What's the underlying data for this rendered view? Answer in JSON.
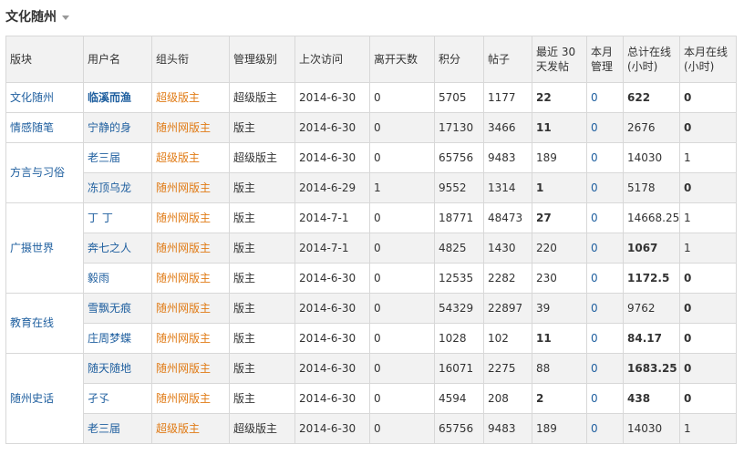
{
  "page_title": "文化随州",
  "columns": [
    "版块",
    "用户名",
    "组头衔",
    "管理级别",
    "上次访问",
    "离开天数",
    "积分",
    "帖子",
    "最近 30 天发帖",
    "本月管理",
    "总计在线(小时)",
    "本月在线(小时)"
  ],
  "header": {
    "section": "版块",
    "user": "用户名",
    "title": "组头衔",
    "level": "管理级别",
    "last_visit": "上次访问",
    "days_away": "离开天数",
    "points": "积分",
    "posts": "帖子",
    "recent30_a": "最近 30",
    "recent30_b": "天发帖",
    "month_manage_a": "本月",
    "month_manage_b": "管理",
    "total_online_a": "总计在线",
    "total_online_b": "(小时)",
    "month_online_a": "本月在线",
    "month_online_b": "(小时)"
  },
  "sections": [
    "文化随州",
    "情感随笔",
    "方言与习俗",
    "广摄世界",
    "教育在线",
    "随州史话"
  ],
  "rows": [
    {
      "user": "临溪而渔",
      "title": "超级版主",
      "level": "超级版主",
      "last": "2014-6-30",
      "days": "0",
      "points": "5705",
      "posts": "1177",
      "recent": "22",
      "manage": "0",
      "total": "622",
      "month": "0"
    },
    {
      "user": "宁静的身",
      "title": "随州网版主",
      "level": "版主",
      "last": "2014-6-30",
      "days": "0",
      "points": "17130",
      "posts": "3466",
      "recent": "11",
      "manage": "0",
      "total": "2676",
      "month": "0"
    },
    {
      "user": "老三届",
      "title": "超级版主",
      "level": "超级版主",
      "last": "2014-6-30",
      "days": "0",
      "points": "65756",
      "posts": "9483",
      "recent": "189",
      "manage": "0",
      "total": "14030",
      "month": "1"
    },
    {
      "user": "冻顶乌龙",
      "title": "随州网版主",
      "level": "版主",
      "last": "2014-6-29",
      "days": "1",
      "points": "9552",
      "posts": "1314",
      "recent": "1",
      "manage": "0",
      "total": "5178",
      "month": "0"
    },
    {
      "user": "丁 丁",
      "title": "随州网版主",
      "level": "版主",
      "last": "2014-7-1",
      "days": "0",
      "points": "18771",
      "posts": "48473",
      "recent": "27",
      "manage": "0",
      "total": "14668.25",
      "month": "1"
    },
    {
      "user": "奔七之人",
      "title": "随州网版主",
      "level": "版主",
      "last": "2014-7-1",
      "days": "0",
      "points": "4825",
      "posts": "1430",
      "recent": "220",
      "manage": "0",
      "total": "1067",
      "month": "1"
    },
    {
      "user": "毅雨",
      "title": "随州网版主",
      "level": "版主",
      "last": "2014-6-30",
      "days": "0",
      "points": "12535",
      "posts": "2282",
      "recent": "230",
      "manage": "0",
      "total": "1172.5",
      "month": "0"
    },
    {
      "user": "雪飘无痕",
      "title": "随州网版主",
      "level": "版主",
      "last": "2014-6-30",
      "days": "0",
      "points": "54329",
      "posts": "22897",
      "recent": "39",
      "manage": "0",
      "total": "9762",
      "month": "0"
    },
    {
      "user": "庄周梦蝶",
      "title": "随州网版主",
      "level": "版主",
      "last": "2014-6-30",
      "days": "0",
      "points": "1028",
      "posts": "102",
      "recent": "11",
      "manage": "0",
      "total": "84.17",
      "month": "0"
    },
    {
      "user": "随天随地",
      "title": "随州网版主",
      "level": "版主",
      "last": "2014-6-30",
      "days": "0",
      "points": "16071",
      "posts": "2275",
      "recent": "88",
      "manage": "0",
      "total": "1683.25",
      "month": "0"
    },
    {
      "user": "孑孓",
      "title": "随州网版主",
      "level": "版主",
      "last": "2014-6-30",
      "days": "0",
      "points": "4594",
      "posts": "208",
      "recent": "2",
      "manage": "0",
      "total": "438",
      "month": "0"
    },
    {
      "user": "老三届",
      "title": "超级版主",
      "level": "超级版主",
      "last": "2014-6-30",
      "days": "0",
      "points": "65756",
      "posts": "9483",
      "recent": "189",
      "manage": "0",
      "total": "14030",
      "month": "1"
    }
  ],
  "colors": {
    "link": "#1f5f9f",
    "super_title": "#e07b16",
    "city_title": "#e07b16",
    "header_bg": "#f2f2f2"
  }
}
